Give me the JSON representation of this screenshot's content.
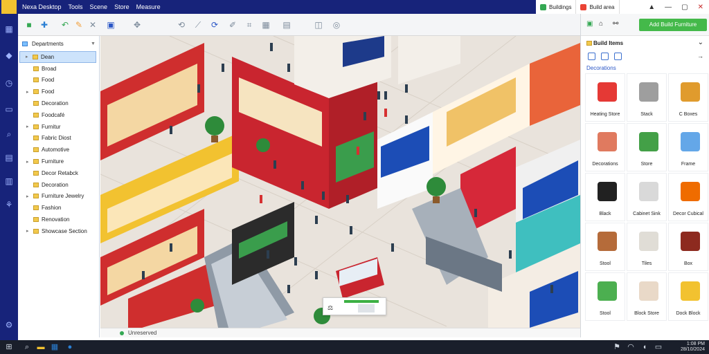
{
  "menu": [
    "Nexa Desktop",
    "Tools",
    "Scene",
    "Store",
    "Measure"
  ],
  "right_tabs": [
    {
      "label": "Buildings",
      "color": "#34a853"
    },
    {
      "label": "Build area",
      "color": "#ea4335"
    }
  ],
  "window_controls": [
    "▲",
    "—",
    "▢",
    "✕"
  ],
  "tree": {
    "header": "Departments",
    "items": [
      {
        "label": "Dean",
        "selected": true
      },
      {
        "label": "Broad"
      },
      {
        "label": "Food"
      },
      {
        "label": "Food"
      },
      {
        "label": "Decoration"
      },
      {
        "label": "Foodcafé"
      },
      {
        "label": "Furnitur"
      },
      {
        "label": "Fabric Diost"
      },
      {
        "label": "Automotive"
      },
      {
        "label": "Furniture"
      },
      {
        "label": "Decor Retabck"
      },
      {
        "label": "Decoration"
      },
      {
        "label": "Furniture Jewelry"
      },
      {
        "label": "Fashion"
      },
      {
        "label": "Renovation"
      },
      {
        "label": "Showcase Section"
      }
    ]
  },
  "status": {
    "text": "Unreserved"
  },
  "right_panel": {
    "action_button": "Add Build Furniture",
    "title": "Build Items",
    "section": "Decorations",
    "items": [
      {
        "label": "Heating Store",
        "color": "#e53935"
      },
      {
        "label": "Stack",
        "color": "#9e9e9e"
      },
      {
        "label": "C Boxes",
        "color": "#e09b2d"
      },
      {
        "label": "Decorations",
        "color": "#e07a5f"
      },
      {
        "label": "Store",
        "color": "#43a047"
      },
      {
        "label": "Frame",
        "color": "#64a7e8"
      },
      {
        "label": "Black",
        "color": "#212121"
      },
      {
        "label": "Cabinet Sink",
        "color": "#d9d9d9"
      },
      {
        "label": "Decor Cubical",
        "color": "#ef6c00"
      },
      {
        "label": "Stool",
        "color": "#b56b3a"
      },
      {
        "label": "Tiles",
        "color": "#e0ddd6"
      },
      {
        "label": "Box",
        "color": "#8d2a1f"
      },
      {
        "label": "Stool",
        "color": "#4caf50"
      },
      {
        "label": "Block Store",
        "color": "#e9d9c8"
      },
      {
        "label": "Dock Block",
        "color": "#f2c230"
      }
    ]
  },
  "clock": {
    "time": "1:08 PM",
    "date": "28/10/2024"
  }
}
